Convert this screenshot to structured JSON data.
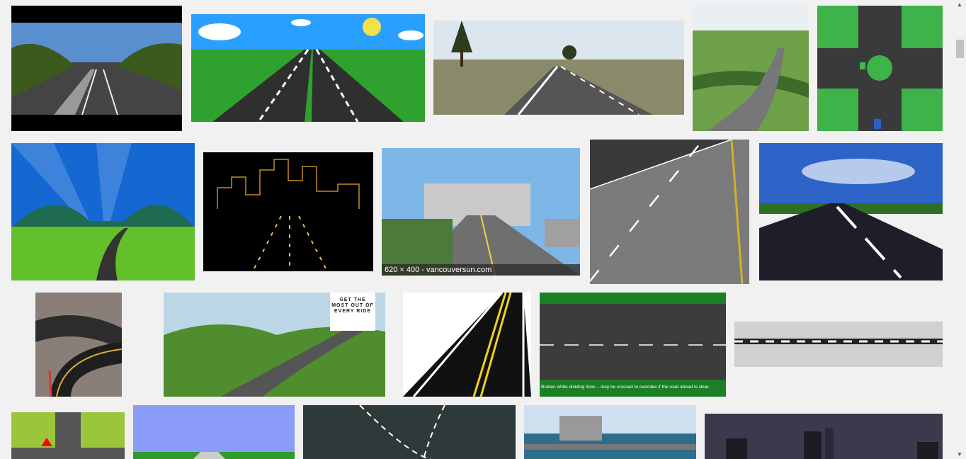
{
  "results": [
    {
      "id": "r1",
      "caption": ""
    },
    {
      "id": "r8",
      "caption": "620 × 400 - vancouversun.com"
    }
  ],
  "ad_tile": {
    "title": "GET THE MOST OUT OF EVERY RIDE"
  },
  "diagram_tile": {
    "bottom_text": "Broken white dividing lines – may be crossed to overtake if the road ahead is clear."
  },
  "colors": {
    "background": "#f1f1f1",
    "sky": "#1e90ff",
    "grass": "#3aa63a",
    "road": "#333333"
  },
  "scrollbar": {
    "up_icon": "arrow-up-icon",
    "down_icon": "arrow-down-icon"
  }
}
